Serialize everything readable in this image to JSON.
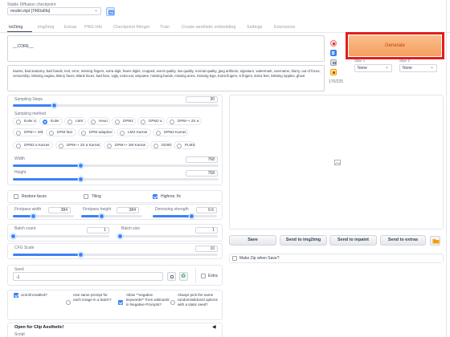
{
  "checkpoint": {
    "label": "Stable Diffusion checkpoint",
    "value": "model.ckpt [7460a6fa]"
  },
  "tabs": [
    "txt2img",
    "img2img",
    "Extras",
    "PNG Info",
    "Checkpoint Merger",
    "Train",
    "Create aesthetic embedding",
    "Settings",
    "Extensions"
  ],
  "prompt": {
    "value": "__CORE__"
  },
  "negative_prompt": {
    "value": "lowres, bad anatomy, bad hands, text, error, missing fingers, extra digit, fewer digits, cropped, worst quality, low quality, normal quality, jpeg artifacts, signature, watermark, username, blurry, out of focus, censorship, Missing vagina,  Blurry faces, Blank faces, bad face, Ugly, extra ear, amputee, missing hands, missing arms, missing legs, Extra fingers, 6 fingers, Extra feet, Missing nipples, ghost"
  },
  "token_counter": "170/225",
  "generate_label": "Generate",
  "styles": [
    {
      "label": "Style 1",
      "value": "None"
    },
    {
      "label": "Style 2",
      "value": "None"
    }
  ],
  "sampling_steps": {
    "label": "Sampling Steps",
    "value": "30",
    "fraction": 0.2
  },
  "sampling_method": {
    "label": "Sampling method",
    "options": [
      "Euler a",
      "Euler",
      "LMS",
      "Heun",
      "DPM2",
      "DPM2 a",
      "DPM++ 2S a",
      "DPM++ 2M",
      "DPM fast",
      "DPM adaptive",
      "LMS Karras",
      "DPM2 Karras",
      "DPM2 a Karras",
      "DPM++ 2S a Karras",
      "DPM++ 2M Karras",
      "DDIM",
      "PLMS"
    ],
    "selected": "Euler"
  },
  "width": {
    "label": "Width",
    "value": "768",
    "fraction": 0.33
  },
  "height": {
    "label": "Height",
    "value": "768",
    "fraction": 0.33
  },
  "restore_faces": {
    "label": "Restore faces",
    "checked": false
  },
  "tiling": {
    "label": "Tiling",
    "checked": false
  },
  "highres_fix": {
    "label": "Highres. fix",
    "checked": true
  },
  "firstpass_width": {
    "label": "Firstpass width",
    "value": "384",
    "fraction": 0.33
  },
  "firstpass_height": {
    "label": "Firstpass height",
    "value": "384",
    "fraction": 0.33
  },
  "denoising": {
    "label": "Denoising strength",
    "value": "0.6",
    "fraction": 0.6
  },
  "batch_count": {
    "label": "Batch count",
    "value": "1",
    "fraction": 0.0
  },
  "batch_size": {
    "label": "Batch size",
    "value": "1",
    "fraction": 0.0
  },
  "cfg_scale": {
    "label": "CFG Scale",
    "value": "10",
    "fraction": 0.33
  },
  "seed": {
    "label": "Seed",
    "value": "-1"
  },
  "extra_label": "Extra",
  "output_buttons": [
    "Save",
    "Send to img2img",
    "Send to inpaint",
    "Send to extras"
  ],
  "make_zip": {
    "label": "Make Zip when Save?",
    "checked": false
  },
  "unmil": {
    "label": "Unmill enabled?",
    "checked": true
  },
  "same_prompt": {
    "label": "Use same prompt for each image in a batch?",
    "checked": false
  },
  "allow_negative": {
    "label": "Allow \"*negative keywords*\" from wildcards in Negative Prompts?",
    "checked": true
  },
  "always_pick": {
    "label": "Always pick the same random/wildcard options with a static seed?",
    "checked": false
  },
  "clip_aesthetic": {
    "label": "Open for Clip Aesthetic!",
    "script_label": "Script"
  },
  "accent_color": "#3b82f6",
  "generate_color": "#f5a86a",
  "highlight_border": "#e11d1d"
}
